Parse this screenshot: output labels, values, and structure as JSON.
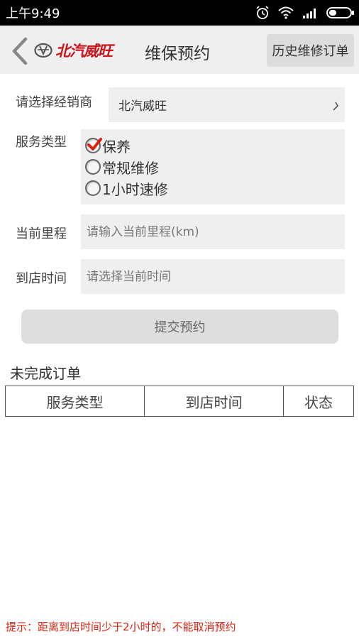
{
  "status_bar": {
    "time": "上午9:49"
  },
  "header": {
    "logo_text": "北汽威旺",
    "title": "维保预约",
    "history_button": "历史维修订单"
  },
  "form": {
    "dealer_label": "请选择经销商",
    "dealer_value": "北汽威旺",
    "service_label": "服务类型",
    "service_options": [
      {
        "label": "保养",
        "checked": true
      },
      {
        "label": "常规维修",
        "checked": false
      },
      {
        "label": "1小时速修",
        "checked": false
      }
    ],
    "mileage_label": "当前里程",
    "mileage_placeholder": "请输入当前里程(km)",
    "time_label": "到店时间",
    "time_placeholder": "请选择当前时间",
    "submit_label": "提交预约"
  },
  "orders": {
    "section_title": "未完成订单",
    "columns": [
      "服务类型",
      "到店时间",
      "状态"
    ]
  },
  "tip": "提示：距离到店时间少于2小时的，不能取消预约",
  "colors": {
    "accent_red": "#c8161d",
    "tip_red": "#d9230f",
    "field_bg": "#efefef"
  }
}
